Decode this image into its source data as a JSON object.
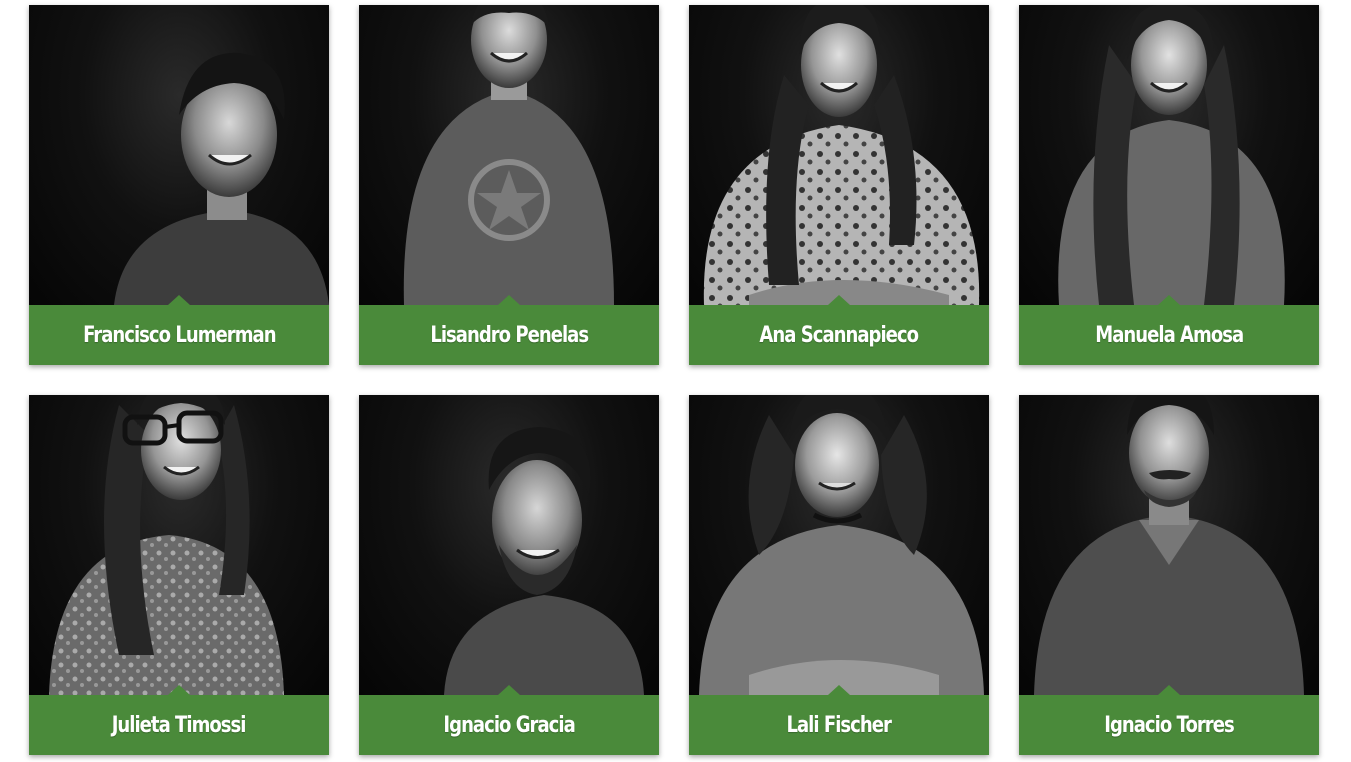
{
  "team": {
    "accent_color": "#4a8a3a",
    "members": [
      {
        "name": "Francisco Lumerman",
        "photo_alt": "portrait-icon"
      },
      {
        "name": "Lisandro Penelas",
        "photo_alt": "portrait-icon"
      },
      {
        "name": "Ana Scannapieco",
        "photo_alt": "portrait-icon"
      },
      {
        "name": "Manuela Amosa",
        "photo_alt": "portrait-icon"
      },
      {
        "name": "Julieta Timossi",
        "photo_alt": "portrait-icon"
      },
      {
        "name": "Ignacio Gracia",
        "photo_alt": "portrait-icon"
      },
      {
        "name": "Lali Fischer",
        "photo_alt": "portrait-icon"
      },
      {
        "name": "Ignacio Torres",
        "photo_alt": "portrait-icon"
      }
    ]
  }
}
